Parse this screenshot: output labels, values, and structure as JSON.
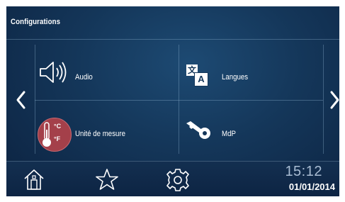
{
  "header": {
    "title": "Configurations"
  },
  "nav": {
    "prev_icon": "chevron-left-icon",
    "next_icon": "chevron-right-icon"
  },
  "tiles": [
    {
      "label": "Audio",
      "icon": "speaker-icon"
    },
    {
      "label": "Langues",
      "icon": "language-icon"
    },
    {
      "label": "Unité de mesure",
      "icon": "thermometer-icon"
    },
    {
      "label": "MdP",
      "icon": "key-icon"
    }
  ],
  "thermometer_units": {
    "celsius": "°C",
    "fahrenheit": "°F"
  },
  "language_glyphs": {
    "source": "文",
    "target": "A"
  },
  "footer": {
    "home_icon": "home-icon",
    "favorites_icon": "star-icon",
    "settings_icon": "gear-icon",
    "time": "15:12",
    "date": "01/01/2014"
  },
  "colors": {
    "background": "#143659",
    "divider": "#5f87aa",
    "thermo_badge": "#a4404a",
    "time_text": "#a9bdd3"
  }
}
